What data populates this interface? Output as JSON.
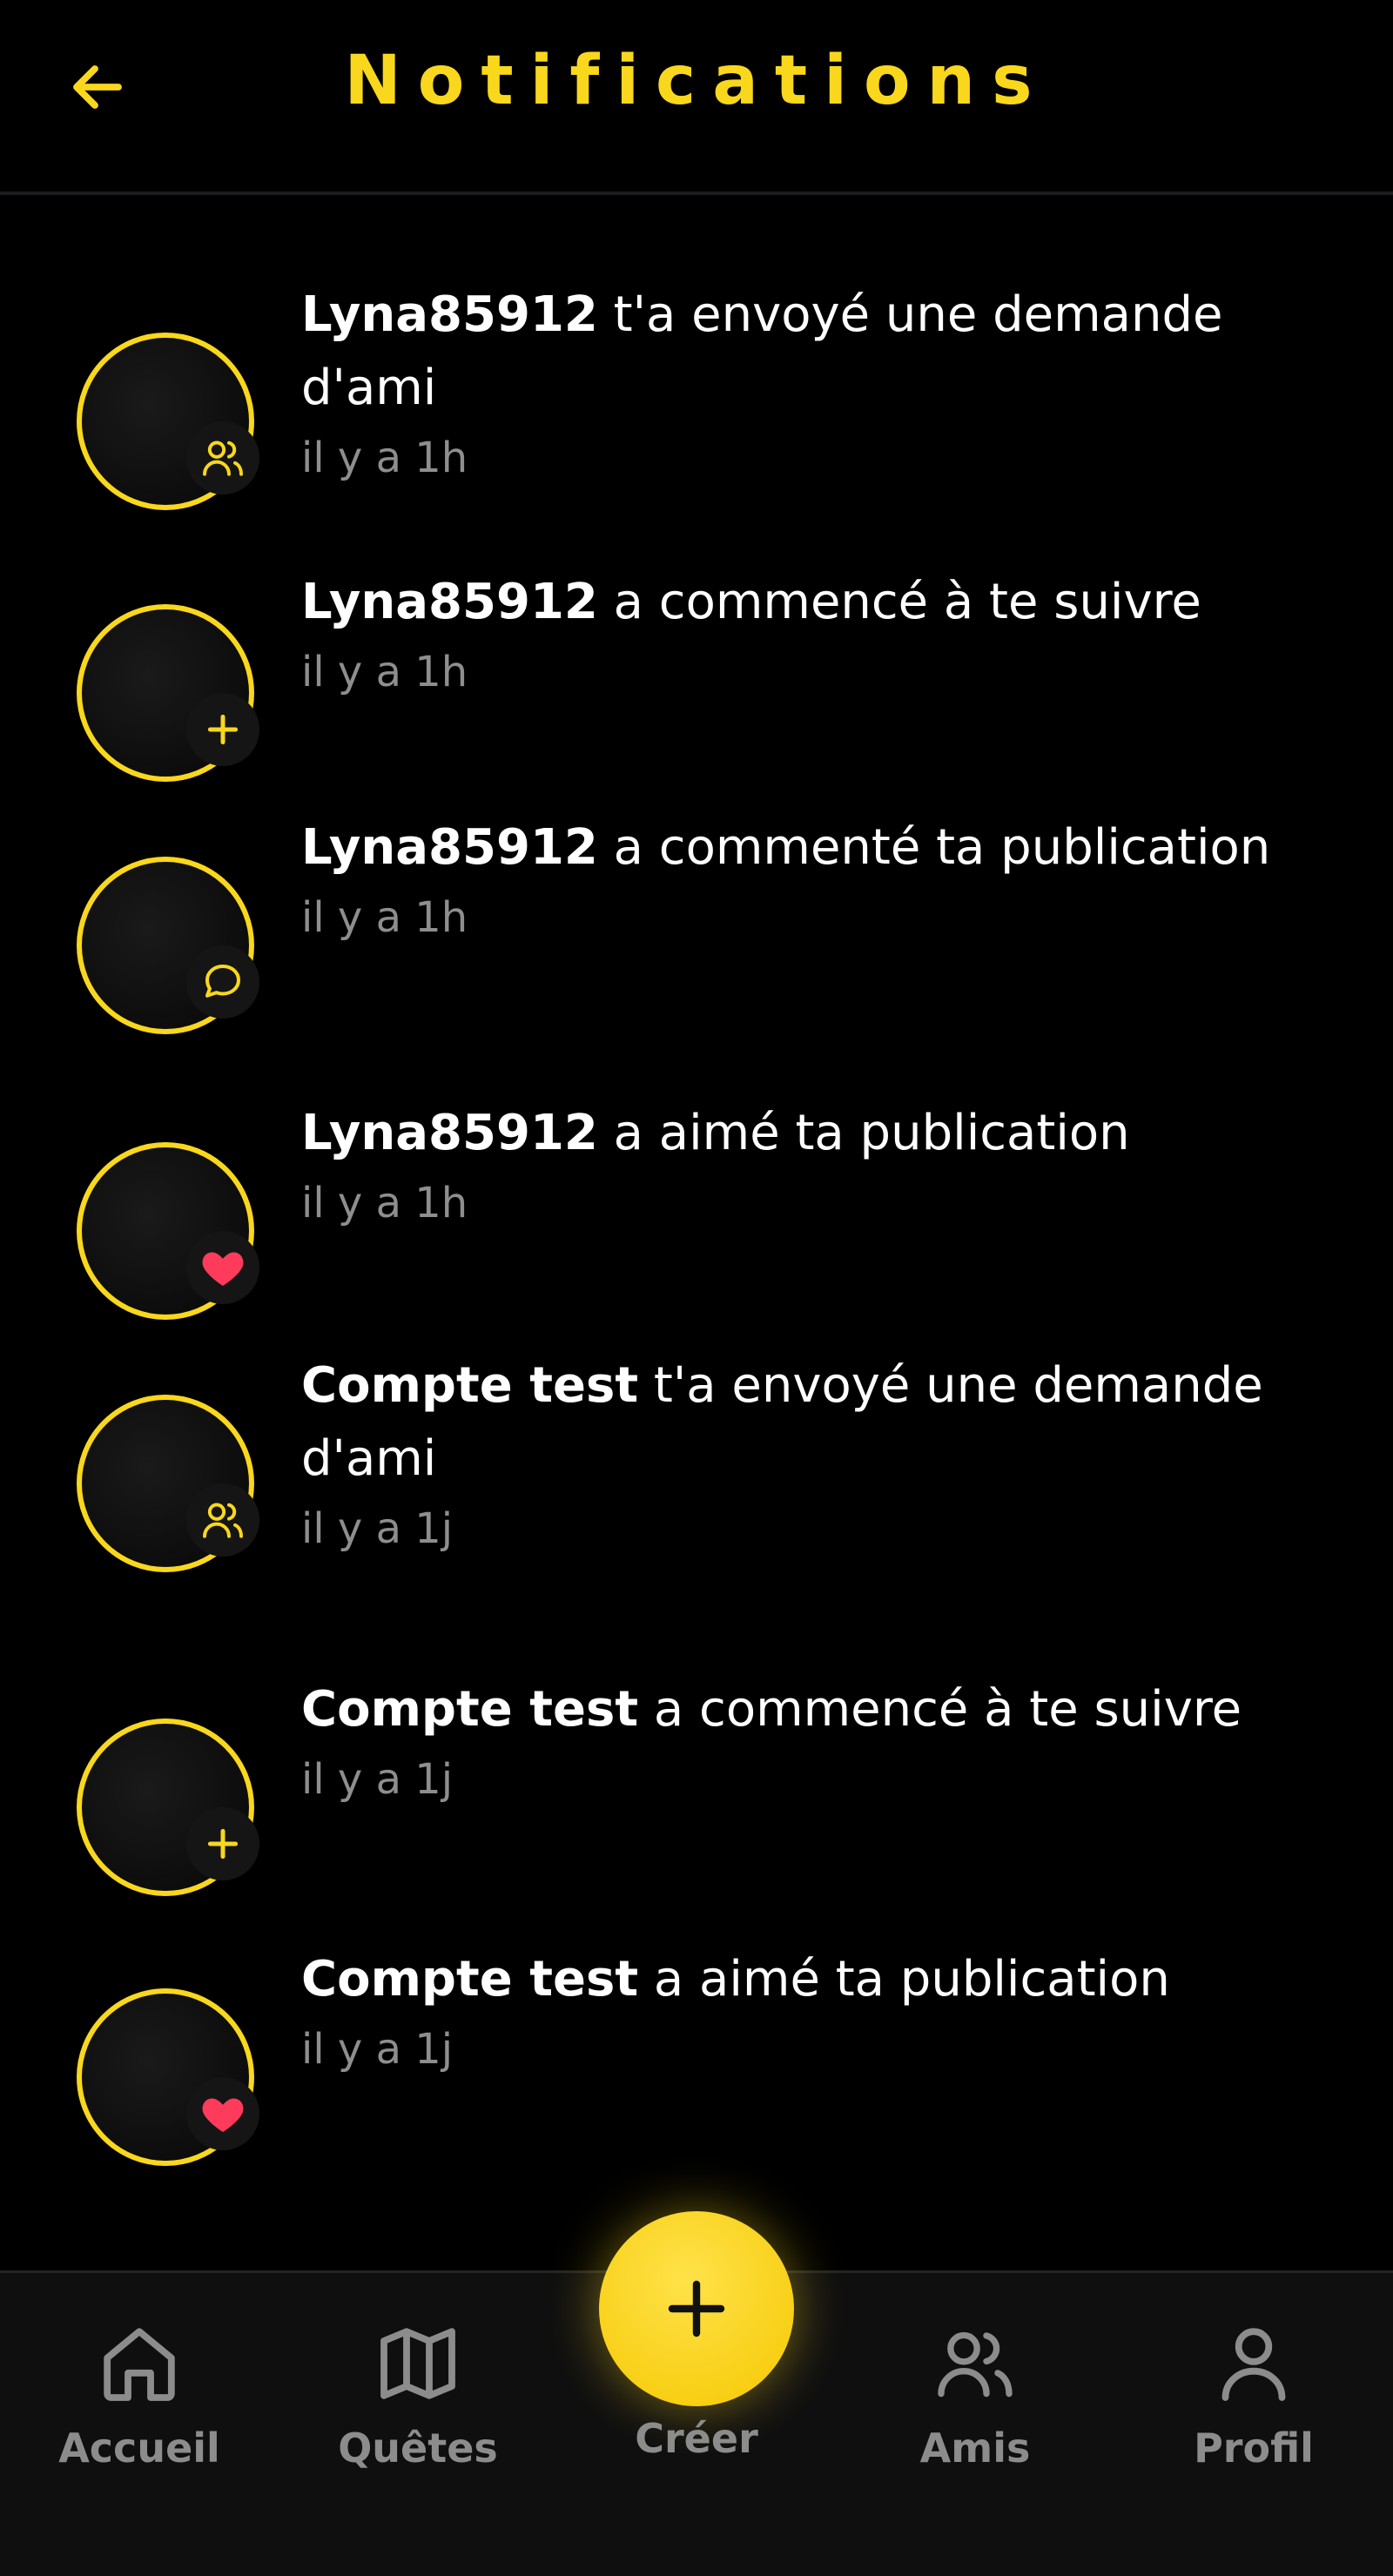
{
  "header": {
    "title": "Notifications",
    "back_icon": "arrow-left-icon"
  },
  "colors": {
    "accent": "#F9D71C",
    "heart": "#FF3B5C",
    "muted": "#8e8e8e"
  },
  "notifications": [
    {
      "user": "Lyna85912",
      "message": " t'a envoyé une demande d'ami",
      "time": "il y a 1h",
      "badge_icon": "friends-icon"
    },
    {
      "user": "Lyna85912",
      "message": " a commencé à te suivre",
      "time": "il y a 1h",
      "badge_icon": "plus-icon"
    },
    {
      "user": "Lyna85912",
      "message": " a commenté ta publication",
      "time": "il y a 1h",
      "badge_icon": "comment-icon"
    },
    {
      "user": "Lyna85912",
      "message": " a aimé ta publication",
      "time": "il y a 1h",
      "badge_icon": "heart-icon"
    },
    {
      "user": "Compte test",
      "message": " t'a envoyé une demande d'ami",
      "time": "il y a 1j",
      "badge_icon": "friends-icon"
    },
    {
      "user": "Compte test",
      "message": " a commencé à te suivre",
      "time": "il y a 1j",
      "badge_icon": "plus-icon"
    },
    {
      "user": "Compte test",
      "message": " a aimé ta publication",
      "time": "il y a 1j",
      "badge_icon": "heart-icon"
    }
  ],
  "nav": {
    "home": "Accueil",
    "quests": "Quêtes",
    "create": "Créer",
    "friends": "Amis",
    "profile": "Profil"
  }
}
